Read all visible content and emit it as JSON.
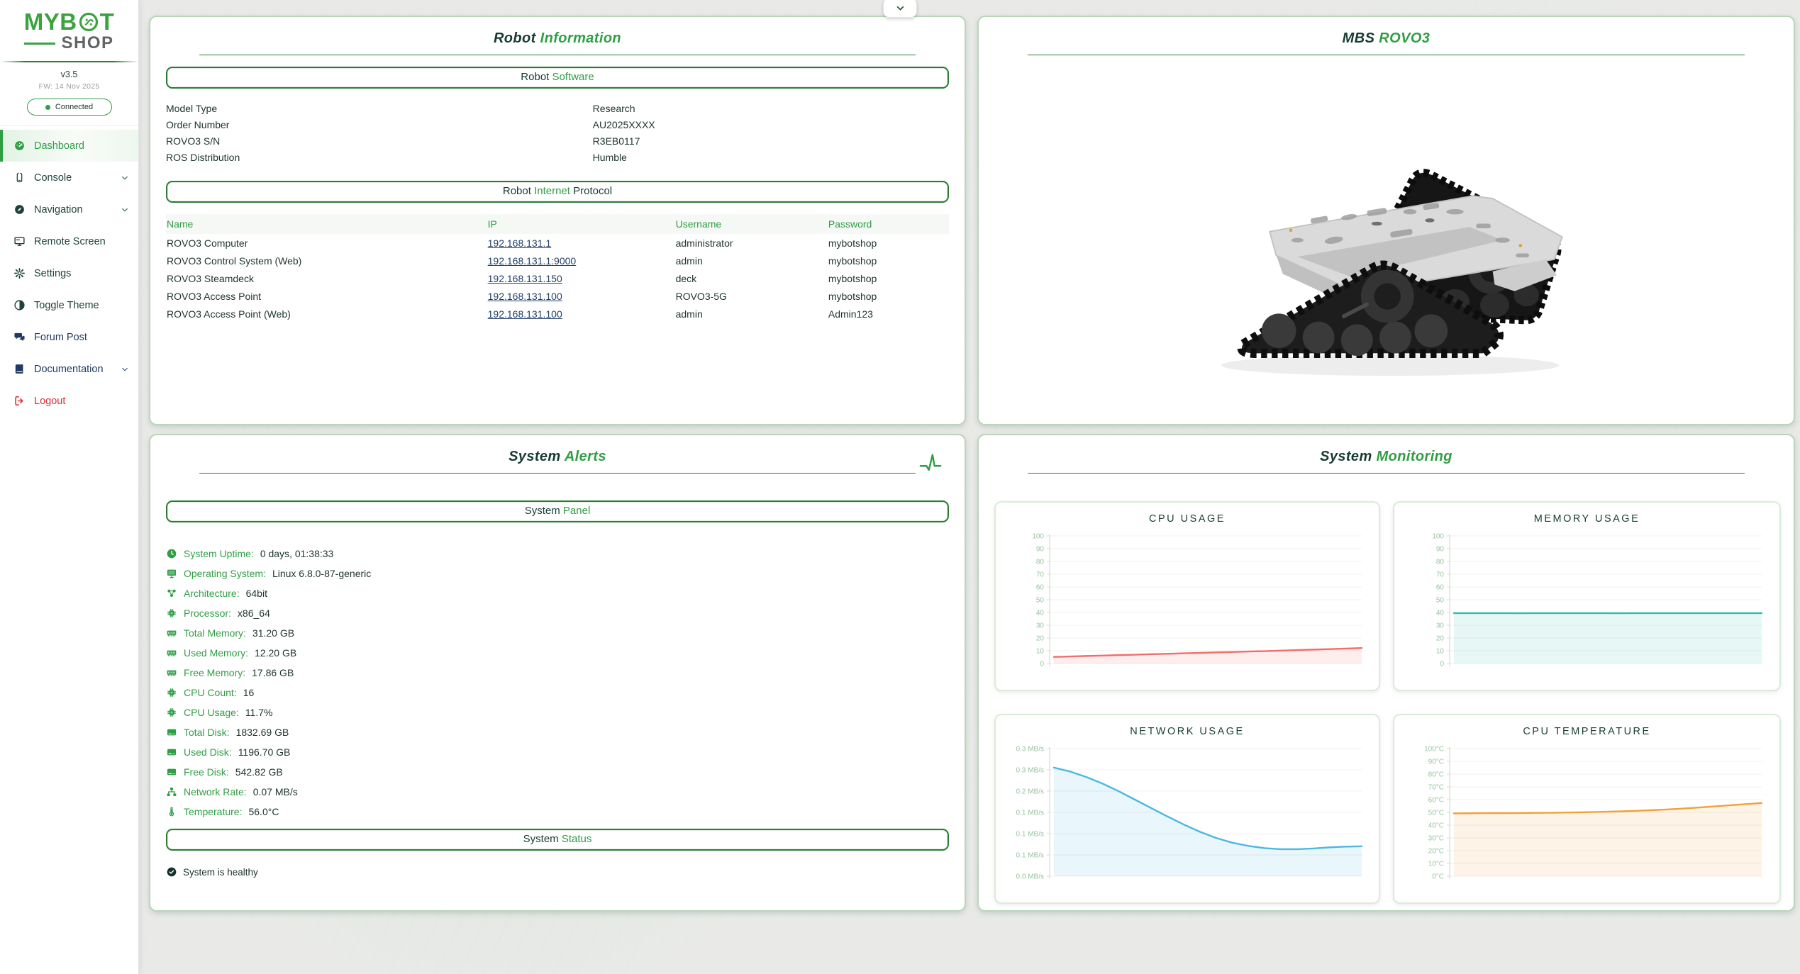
{
  "colors": {
    "accent_green": "#2f9e44",
    "dark_green_text": "#173a32",
    "logo_green": "#3aa33f",
    "logout_red": "#d63031",
    "link_navy": "#22406b",
    "card_border": "#b9d6ba",
    "cpu_line": "#f26d6d",
    "memory_line": "#2fbcb2",
    "network_line": "#4db8e0",
    "temperature_line": "#f0a13a"
  },
  "sidebar": {
    "logo_line1": "MYB",
    "logo_line1_end": "T",
    "logo_line2": "SHOP",
    "version": "v3.5",
    "firmware": "FW: 14 Nov 2025",
    "status": "Connected",
    "menu": [
      {
        "label": "Dashboard",
        "icon": "dashboard-icon",
        "active": true,
        "color": "green",
        "chevron": false
      },
      {
        "label": "Console",
        "icon": "console-icon",
        "color": "default",
        "chevron": true
      },
      {
        "label": "Navigation",
        "icon": "navigation-icon",
        "color": "default",
        "chevron": true
      },
      {
        "label": "Remote Screen",
        "icon": "remote-screen-icon",
        "color": "default",
        "chevron": false
      },
      {
        "label": "Settings",
        "icon": "settings-icon",
        "color": "default",
        "chevron": false
      },
      {
        "label": "Toggle Theme",
        "icon": "theme-icon",
        "color": "default",
        "chevron": false
      },
      {
        "label": "Forum Post",
        "icon": "forum-icon",
        "color": "navy",
        "chevron": false
      },
      {
        "label": "Documentation",
        "icon": "docs-icon",
        "color": "navy",
        "chevron": true
      },
      {
        "label": "Logout",
        "icon": "logout-icon",
        "color": "red",
        "chevron": false
      }
    ]
  },
  "robot_info": {
    "title": {
      "pre": "Robot ",
      "accent": "Information",
      "post": ""
    },
    "software_header": {
      "pre": "Robot ",
      "accent": "Software",
      "post": ""
    },
    "fields": [
      {
        "label": "Model Type",
        "value": "Research"
      },
      {
        "label": "Order Number",
        "value": "AU2025XXXX"
      },
      {
        "label": "ROVO3 S/N",
        "value": "R3EB0117"
      },
      {
        "label": "ROS Distribution",
        "value": "Humble"
      }
    ],
    "ip_header": {
      "pre": "Robot ",
      "accent": "Internet",
      "post": " Protocol"
    },
    "table": {
      "headers": [
        "Name",
        "IP",
        "Username",
        "Password"
      ],
      "rows": [
        {
          "name": "ROVO3 Computer",
          "ip": "192.168.131.1",
          "username": "administrator",
          "password": "mybotshop"
        },
        {
          "name": "ROVO3 Control System (Web)",
          "ip": "192.168.131.1:9000",
          "username": "admin",
          "password": "mybotshop"
        },
        {
          "name": "ROVO3 Steamdeck",
          "ip": "192.168.131.150",
          "username": "deck",
          "password": "mybotshop"
        },
        {
          "name": "ROVO3 Access Point",
          "ip": "192.168.131.100",
          "username": "ROVO3-5G",
          "password": "mybotshop"
        },
        {
          "name": "ROVO3 Access Point (Web)",
          "ip": "192.168.131.100",
          "username": "admin",
          "password": "Admin123"
        }
      ]
    }
  },
  "robot_view": {
    "title": {
      "pre": "MBS ",
      "accent": "ROVO3",
      "post": ""
    }
  },
  "system_alerts": {
    "title": {
      "pre": "System ",
      "accent": "Alerts",
      "post": ""
    },
    "panel_header": {
      "pre": "System ",
      "accent": "Panel",
      "post": ""
    },
    "stats": [
      {
        "icon": "clock-icon",
        "label": "System Uptime:",
        "value": "0 days, 01:38:33"
      },
      {
        "icon": "monitor-icon",
        "label": "Operating System:",
        "value": "Linux 6.8.0-87-generic"
      },
      {
        "icon": "architecture-icon",
        "label": "Architecture:",
        "value": "64bit"
      },
      {
        "icon": "chip-icon",
        "label": "Processor:",
        "value": "x86_64"
      },
      {
        "icon": "memory-icon",
        "label": "Total Memory:",
        "value": "31.20 GB"
      },
      {
        "icon": "memory-icon",
        "label": "Used Memory:",
        "value": "12.20 GB"
      },
      {
        "icon": "memory-icon",
        "label": "Free Memory:",
        "value": "17.86 GB"
      },
      {
        "icon": "chip-icon",
        "label": "CPU Count:",
        "value": "16"
      },
      {
        "icon": "chip-icon",
        "label": "CPU Usage:",
        "value": "11.7%"
      },
      {
        "icon": "disk-icon",
        "label": "Total Disk:",
        "value": "1832.69 GB"
      },
      {
        "icon": "disk-icon",
        "label": "Used Disk:",
        "value": "1196.70 GB"
      },
      {
        "icon": "disk-icon",
        "label": "Free Disk:",
        "value": "542.82 GB"
      },
      {
        "icon": "network-icon",
        "label": "Network Rate:",
        "value": "0.07 MB/s"
      },
      {
        "icon": "thermometer-icon",
        "label": "Temperature:",
        "value": "56.0°C"
      }
    ],
    "status_header": {
      "pre": "System ",
      "accent": "Status",
      "post": ""
    },
    "health": "System is healthy"
  },
  "monitoring": {
    "title": {
      "pre": "System ",
      "accent": "Monitoring",
      "post": ""
    }
  },
  "chart_data": [
    {
      "id": "cpu-usage",
      "type": "area",
      "title": "CPU USAGE",
      "ylabel": "percent",
      "ylim": [
        0,
        100
      ],
      "grid": true,
      "legend": "none",
      "x_labels": [],
      "yticks": [
        "100",
        "90",
        "80",
        "70",
        "60",
        "50",
        "40",
        "30",
        "20",
        "10",
        "0"
      ],
      "values": [
        5.2,
        5.5,
        5.9,
        6.2,
        6.6,
        6.9,
        7.3,
        7.6,
        8.0,
        8.3,
        8.7,
        9.0,
        9.4,
        9.7,
        10.1,
        10.5,
        10.9,
        11.3,
        11.7,
        12.1
      ],
      "color": "#f26d6d"
    },
    {
      "id": "memory-usage",
      "type": "area",
      "title": "MEMORY USAGE",
      "ylabel": "percent",
      "ylim": [
        0,
        100
      ],
      "grid": true,
      "legend": "none",
      "x_labels": [],
      "yticks": [
        "100",
        "90",
        "80",
        "70",
        "60",
        "50",
        "40",
        "30",
        "20",
        "10",
        "0"
      ],
      "values": [
        39.5,
        39.5,
        39.5,
        39.5,
        39.4,
        39.5,
        39.5,
        39.5,
        39.5,
        39.5,
        39.4,
        39.5,
        39.5,
        39.5,
        39.5,
        39.5,
        39.5,
        39.5,
        39.5,
        39.5
      ],
      "color": "#2fbcb2"
    },
    {
      "id": "network-usage",
      "type": "area",
      "title": "NETWORK USAGE",
      "ylabel": "MB/s",
      "ylim": [
        0,
        0.35
      ],
      "grid": true,
      "legend": "none",
      "x_labels": [],
      "yticks": [
        "0.3 MB/s",
        "0.3 MB/s",
        "0.2 MB/s",
        "0.1 MB/s",
        "0.1 MB/s",
        "0.1 MB/s",
        "0.0 MB/s"
      ],
      "values": [
        0.298,
        0.287,
        0.272,
        0.254,
        0.233,
        0.21,
        0.187,
        0.164,
        0.142,
        0.122,
        0.105,
        0.092,
        0.083,
        0.077,
        0.074,
        0.074,
        0.076,
        0.079,
        0.081,
        0.082
      ],
      "color": "#4db8e0"
    },
    {
      "id": "cpu-temperature",
      "type": "area",
      "title": "CPU TEMPERATURE",
      "ylabel": "°C",
      "ylim": [
        0,
        100
      ],
      "grid": true,
      "legend": "none",
      "x_labels": [],
      "yticks": [
        "100°C",
        "90°C",
        "80°C",
        "70°C",
        "60°C",
        "50°C",
        "40°C",
        "30°C",
        "20°C",
        "10°C",
        "0°C"
      ],
      "values": [
        49.2,
        49.3,
        49.4,
        49.4,
        49.5,
        49.6,
        49.7,
        49.9,
        50.1,
        50.4,
        50.7,
        51.1,
        51.6,
        52.2,
        52.9,
        53.7,
        54.6,
        55.5,
        56.4,
        57.3
      ],
      "color": "#f0a13a"
    }
  ]
}
